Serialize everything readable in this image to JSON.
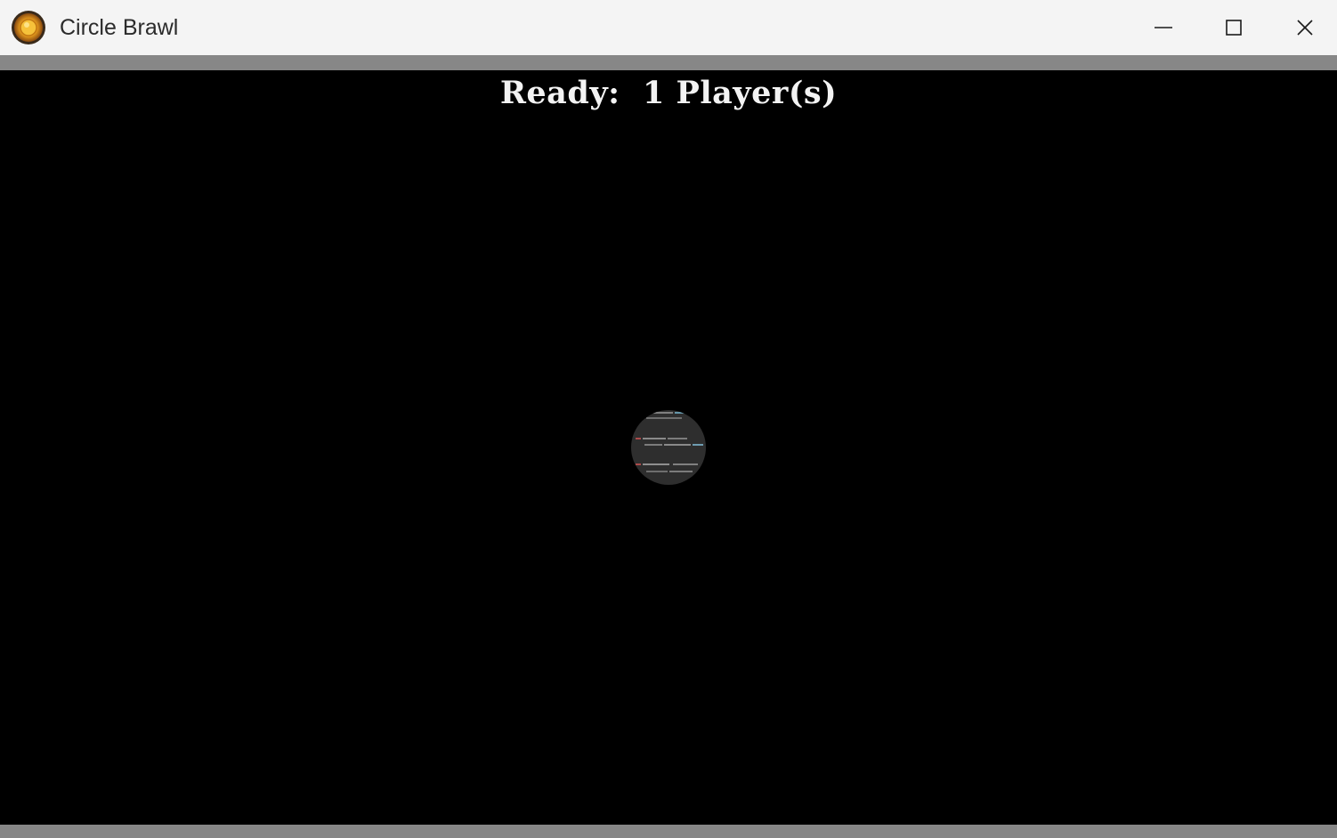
{
  "window": {
    "title": "Circle Brawl",
    "app_icon": "circle-brawl-logo-icon",
    "controls": {
      "minimize": "minimize-icon",
      "maximize": "maximize-icon",
      "close": "close-icon"
    }
  },
  "game": {
    "status_label": "Ready:",
    "player_count": "1 Player(s)",
    "player_sprite": "player-circle",
    "background_color": "#000000",
    "frame_color": "#878787"
  }
}
